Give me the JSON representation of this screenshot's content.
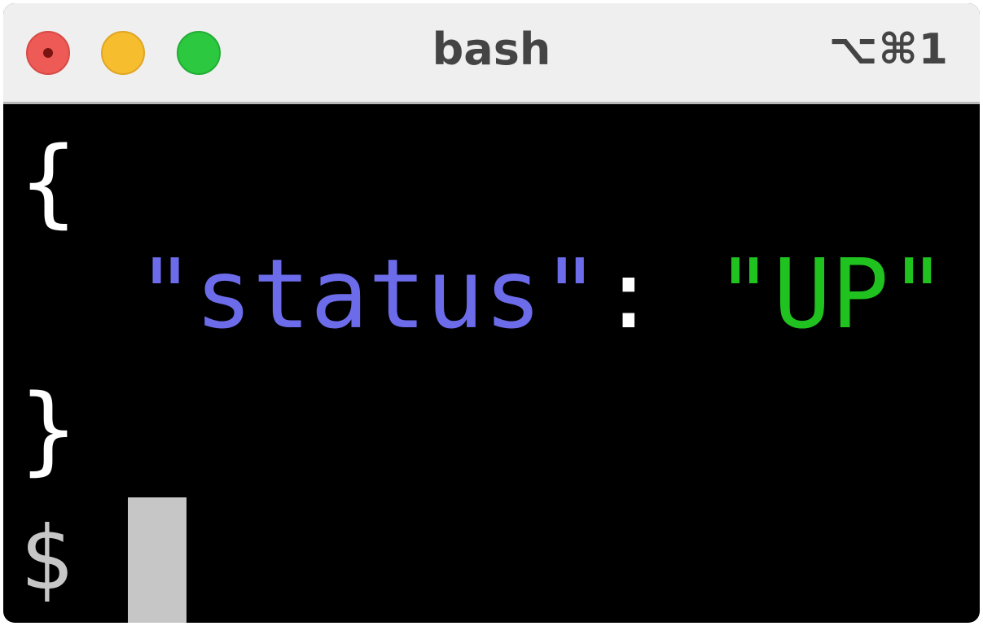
{
  "window": {
    "title": "bash",
    "shortcut": "⌥⌘1"
  },
  "traffic_lights": {
    "close_color": "#ee5a55",
    "minimize_color": "#f6bd2f",
    "zoom_color": "#2bc840"
  },
  "terminal": {
    "background": "#000000",
    "lines": {
      "open_brace": "{",
      "key": "\"status\"",
      "colon": ": ",
      "value": "\"UP\"",
      "close_brace": "}"
    },
    "colors": {
      "key": "#6c6cea",
      "value": "#1fc21f",
      "punctuation": "#ffffff"
    },
    "prompt": "$"
  }
}
